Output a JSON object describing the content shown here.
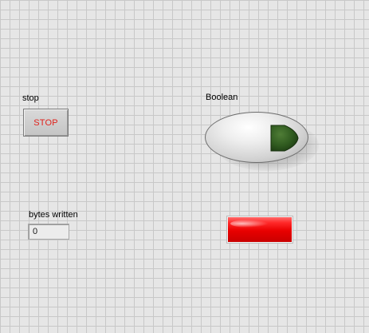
{
  "stop_control": {
    "label": "stop",
    "button_text": "STOP",
    "text_color": "#e0201a"
  },
  "boolean_control": {
    "label": "Boolean",
    "led_icon": "play-triangle-icon",
    "led_color": "#2f5a1f"
  },
  "bytes_written_indicator": {
    "label": "bytes written",
    "value": "0"
  },
  "red_led_indicator": {
    "state": "on",
    "color": "#e80000"
  }
}
